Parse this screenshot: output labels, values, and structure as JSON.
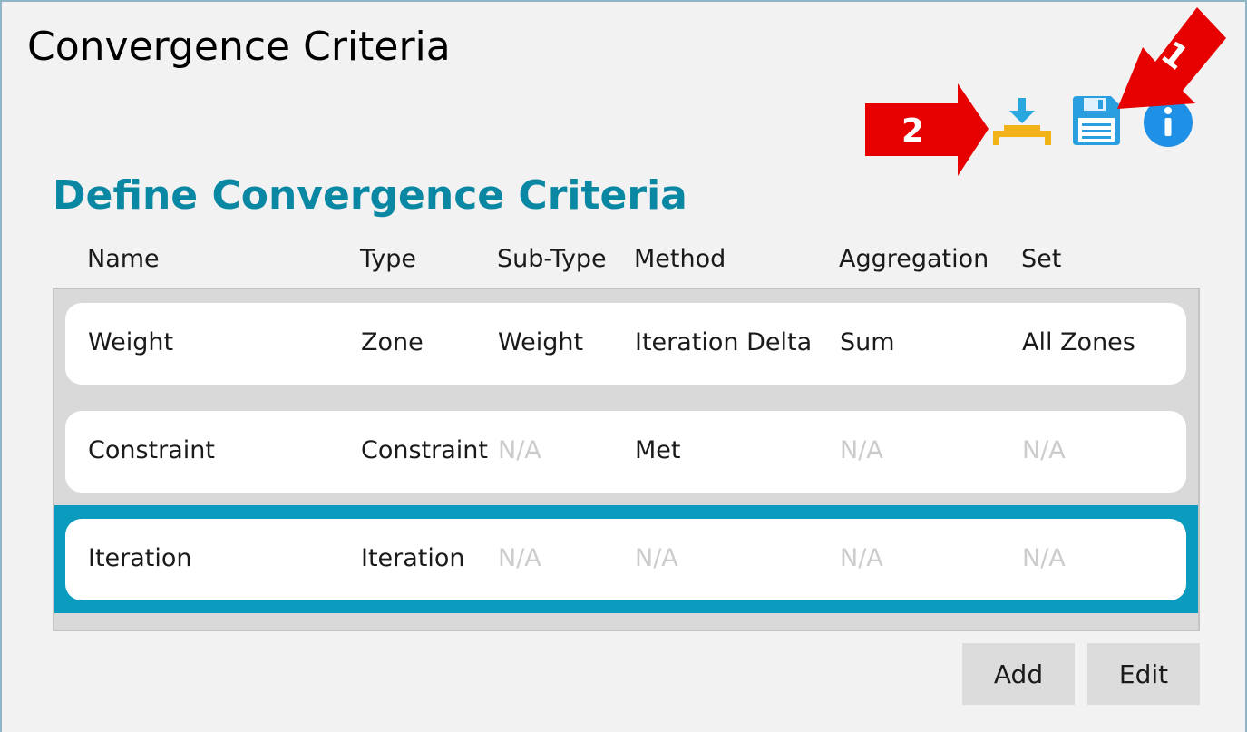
{
  "window": {
    "title": "Convergence Criteria"
  },
  "toolbar": {
    "icons": [
      "import-icon",
      "save-icon",
      "info-icon"
    ],
    "colors": {
      "import_arrow": "#29a8e0",
      "import_base": "#f2b318",
      "save": "#2a9fe0",
      "info": "#1e90e6"
    }
  },
  "annotations": {
    "callout_1": "1",
    "callout_2": "2",
    "color": "#e60000"
  },
  "section": {
    "title": "Define Convergence Criteria",
    "color": "#0a88a3"
  },
  "table": {
    "columns": [
      "Name",
      "Type",
      "Sub-Type",
      "Method",
      "Aggregation",
      "Set"
    ],
    "rows": [
      {
        "name": "Weight",
        "type": "Zone",
        "subtype": "Weight",
        "method": "Iteration Delta",
        "aggregation": "Sum",
        "set": "All Zones"
      },
      {
        "name": "Constraint",
        "type": "Constraint",
        "subtype": "N/A",
        "method": "Met",
        "aggregation": "N/A",
        "set": "N/A"
      },
      {
        "name": "Iteration",
        "type": "Iteration",
        "subtype": "N/A",
        "method": "N/A",
        "aggregation": "N/A",
        "set": "N/A"
      }
    ],
    "selected_row": 2,
    "selection_color": "#0a9bbf"
  },
  "buttons": {
    "add": "Add",
    "edit": "Edit"
  }
}
